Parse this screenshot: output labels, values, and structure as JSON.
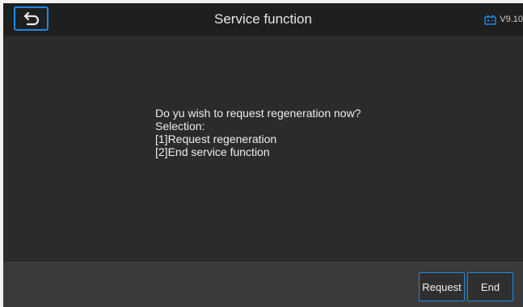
{
  "header": {
    "title": "Service function",
    "version": "V9.10",
    "back_icon": "back-arrow-icon",
    "battery_icon": "battery-icon"
  },
  "message": {
    "lines": [
      "Do yu wish to request regeneration now?",
      "Selection:",
      "[1]Request regeneration",
      "[2]End service function"
    ]
  },
  "footer": {
    "request_label": "Request",
    "end_label": "End"
  },
  "colors": {
    "accent": "#1e88e5",
    "background": "#2b2b2b",
    "header": "#1f1f1f",
    "footer": "#3a3a3a"
  }
}
